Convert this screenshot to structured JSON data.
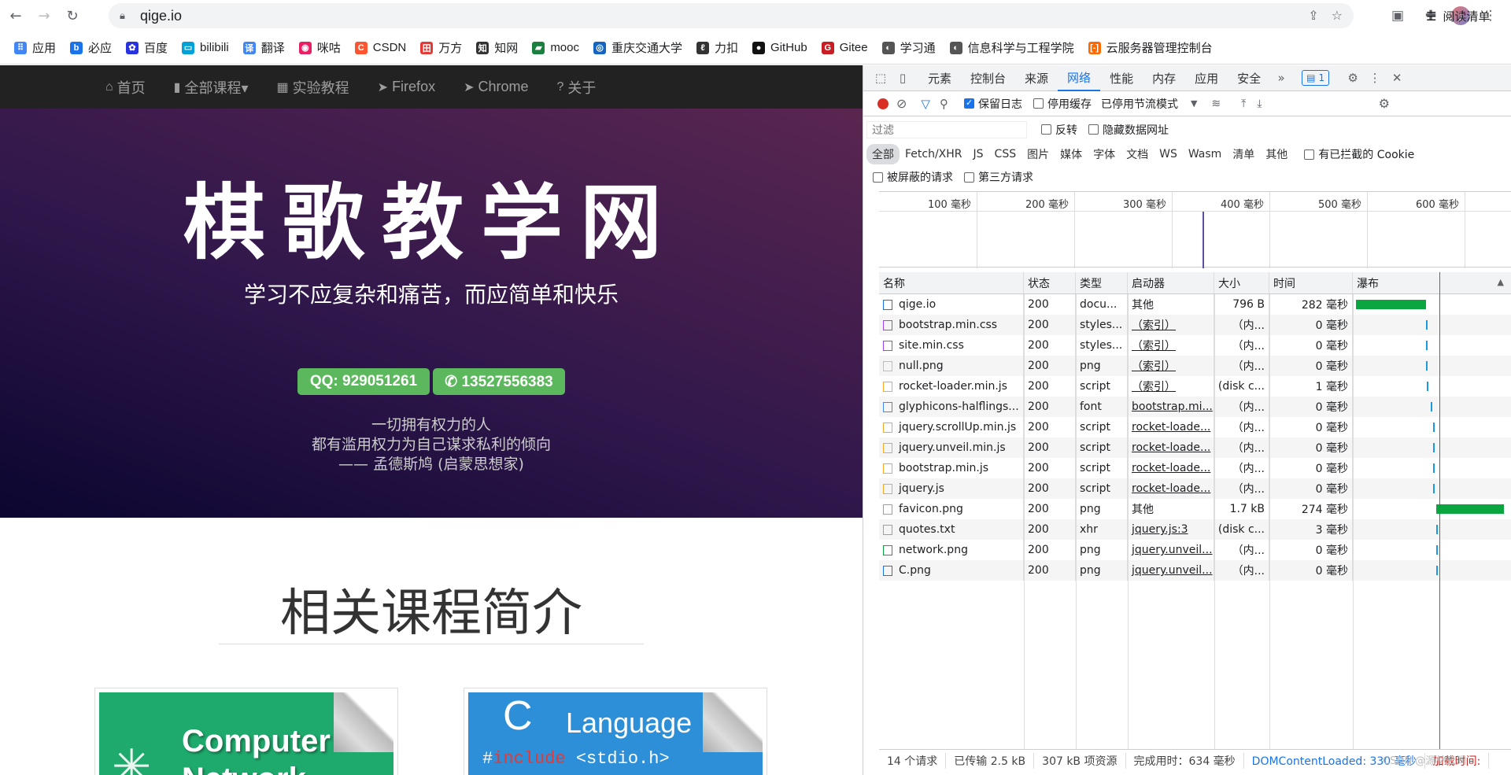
{
  "browser": {
    "url": "qige.io",
    "bookmarks": [
      {
        "label": "应用",
        "color": "#4285f4"
      },
      {
        "label": "必应",
        "color": "#1a73e8"
      },
      {
        "label": "百度",
        "color": "#2932e1"
      },
      {
        "label": "bilibili",
        "color": "#00a1d6"
      },
      {
        "label": "翻译",
        "color": "#4285f4"
      },
      {
        "label": "咪咕",
        "color": "#e91e63"
      },
      {
        "label": "CSDN",
        "color": "#fc5531"
      },
      {
        "label": "万方",
        "color": "#e53935"
      },
      {
        "label": "知网",
        "color": "#333333"
      },
      {
        "label": "mooc",
        "color": "#1b7f3f"
      },
      {
        "label": "重庆交通大学",
        "color": "#1565c0"
      },
      {
        "label": "力扣",
        "color": "#333333"
      },
      {
        "label": "GitHub",
        "color": "#111111"
      },
      {
        "label": "Gitee",
        "color": "#c71d23"
      },
      {
        "label": "学习通",
        "color": "#555555"
      },
      {
        "label": "信息科学与工程学院",
        "color": "#555555"
      },
      {
        "label": "云服务器管理控制台",
        "color": "#ff6a00"
      }
    ],
    "more": "»",
    "reading_list": "阅读清单"
  },
  "site": {
    "nav": [
      {
        "icon": "⌂",
        "label": "首页"
      },
      {
        "icon": "▮",
        "label": "全部课程▾"
      },
      {
        "icon": "▦",
        "label": "实验教程"
      },
      {
        "icon": "➤",
        "label": "Firefox"
      },
      {
        "icon": "➤",
        "label": "Chrome"
      },
      {
        "icon": "?",
        "label": "关于"
      }
    ],
    "hero_title": "棋歌教学网",
    "hero_subtitle": "学习不应复杂和痛苦，而应简单和快乐",
    "qq": "QQ: 929051261",
    "phone": "✆ 13527556383",
    "quote": [
      "一切拥有权力的人",
      "都有滥用权力为自己谋求私利的倾向",
      "—— 孟德斯鸠 (启蒙思想家)"
    ],
    "courses_title": "相关课程简介",
    "card1": {
      "title": "Computer",
      "subtitle": "Network",
      "color": "#1faa6d"
    },
    "card2": {
      "title": "C",
      "subtitle": "Language",
      "code_hash": "#",
      "code_kw": "include",
      "code_rest": "<stdio.h>",
      "color": "#2c8fd8"
    }
  },
  "devtools": {
    "tabs": [
      "元素",
      "控制台",
      "来源",
      "网络",
      "性能",
      "内存",
      "应用",
      "安全"
    ],
    "active_tab": "网络",
    "more_tabs": "»",
    "badge": "1",
    "preserve_log": "保留日志",
    "disable_cache": "停用缓存",
    "throttle": "已停用节流模式",
    "filter_placeholder": "过滤",
    "invert": "反转",
    "hide_data": "隐藏数据网址",
    "types": [
      "全部",
      "Fetch/XHR",
      "JS",
      "CSS",
      "图片",
      "媒体",
      "字体",
      "文档",
      "WS",
      "Wasm",
      "清单",
      "其他"
    ],
    "blocked_cookies": "有已拦截的 Cookie",
    "blocked_requests": "被屏蔽的请求",
    "third_party": "第三方请求",
    "timeline_labels": [
      "100 毫秒",
      "200 毫秒",
      "300 毫秒",
      "400 毫秒",
      "500 毫秒",
      "600 毫秒"
    ],
    "columns": [
      "名称",
      "状态",
      "类型",
      "启动器",
      "大小",
      "时间",
      "瀑布"
    ],
    "rows": [
      {
        "name": "qige.io",
        "status": "200",
        "type": "docu...",
        "initiator": "其他",
        "link": false,
        "size": "796 B",
        "time": "282 毫秒",
        "icon": "#1a73e8",
        "wf_start": 0.0,
        "wf_dur": 0.282,
        "wf_color": "#0ca640"
      },
      {
        "name": "bootstrap.min.css",
        "status": "200",
        "type": "styles...",
        "initiator": "（索引）",
        "link": true,
        "size": "（内...",
        "time": "0 毫秒",
        "icon": "#a142f4",
        "wf_start": 0.282,
        "wf_dur": 0.004,
        "wf_color": "#1a9ae0"
      },
      {
        "name": "site.min.css",
        "status": "200",
        "type": "styles...",
        "initiator": "（索引）",
        "link": true,
        "size": "（内...",
        "time": "0 毫秒",
        "icon": "#a142f4",
        "wf_start": 0.282,
        "wf_dur": 0.004,
        "wf_color": "#1a9ae0"
      },
      {
        "name": "null.png",
        "status": "200",
        "type": "png",
        "initiator": "（索引）",
        "link": true,
        "size": "（内...",
        "time": "0 毫秒",
        "icon": "#bdbdbd",
        "wf_start": 0.282,
        "wf_dur": 0.004,
        "wf_color": "#1a9ae0"
      },
      {
        "name": "rocket-loader.min.js",
        "status": "200",
        "type": "script",
        "initiator": "（索引）",
        "link": true,
        "size": "(disk c...",
        "time": "1 毫秒",
        "icon": "#f9a825",
        "wf_start": 0.285,
        "wf_dur": 0.006,
        "wf_color": "#1a9ae0"
      },
      {
        "name": "glyphicons-halflings...",
        "status": "200",
        "type": "font",
        "initiator": "bootstrap.mi...",
        "link": true,
        "size": "（内...",
        "time": "0 毫秒",
        "icon": "#4285f4",
        "wf_start": 0.3,
        "wf_dur": 0.004,
        "wf_color": "#1a9ae0"
      },
      {
        "name": "jquery.scrollUp.min.js",
        "status": "200",
        "type": "script",
        "initiator": "rocket-loade...",
        "link": true,
        "size": "（内...",
        "time": "0 毫秒",
        "icon": "#f9a825",
        "wf_start": 0.31,
        "wf_dur": 0.004,
        "wf_color": "#1a9ae0"
      },
      {
        "name": "jquery.unveil.min.js",
        "status": "200",
        "type": "script",
        "initiator": "rocket-loade...",
        "link": true,
        "size": "（内...",
        "time": "0 毫秒",
        "icon": "#f9a825",
        "wf_start": 0.31,
        "wf_dur": 0.004,
        "wf_color": "#1a9ae0"
      },
      {
        "name": "bootstrap.min.js",
        "status": "200",
        "type": "script",
        "initiator": "rocket-loade...",
        "link": true,
        "size": "（内...",
        "time": "0 毫秒",
        "icon": "#f9a825",
        "wf_start": 0.31,
        "wf_dur": 0.004,
        "wf_color": "#1a9ae0"
      },
      {
        "name": "jquery.js",
        "status": "200",
        "type": "script",
        "initiator": "rocket-loade...",
        "link": true,
        "size": "（内...",
        "time": "0 毫秒",
        "icon": "#f9a825",
        "wf_start": 0.31,
        "wf_dur": 0.004,
        "wf_color": "#1a9ae0"
      },
      {
        "name": "favicon.png",
        "status": "200",
        "type": "png",
        "initiator": "其他",
        "link": false,
        "size": "1.7 kB",
        "time": "274 毫秒",
        "icon": "#9e9e9e",
        "wf_start": 0.322,
        "wf_dur": 0.274,
        "wf_color": "#0ca640"
      },
      {
        "name": "quotes.txt",
        "status": "200",
        "type": "xhr",
        "initiator": "jquery.js:3",
        "link": true,
        "size": "(disk c...",
        "time": "3 毫秒",
        "icon": "#9e9e9e",
        "wf_start": 0.322,
        "wf_dur": 0.006,
        "wf_color": "#1a9ae0"
      },
      {
        "name": "network.png",
        "status": "200",
        "type": "png",
        "initiator": "jquery.unveil...",
        "link": true,
        "size": "（内...",
        "time": "0 毫秒",
        "icon": "#0ca640",
        "wf_start": 0.324,
        "wf_dur": 0.004,
        "wf_color": "#1a9ae0"
      },
      {
        "name": "C.png",
        "status": "200",
        "type": "png",
        "initiator": "jquery.unveil...",
        "link": true,
        "size": "（内...",
        "time": "0 毫秒",
        "icon": "#1a73e8",
        "wf_start": 0.324,
        "wf_dur": 0.004,
        "wf_color": "#1a9ae0"
      }
    ],
    "status_bar": [
      "14 个请求",
      "已传输 2.5 kB",
      "307 kB 项资源",
      "完成用时：634 毫秒",
      "DOMContentLoaded: 330 毫秒",
      "加载时间:"
    ],
    "watermark": "CSDN @源林云间"
  }
}
